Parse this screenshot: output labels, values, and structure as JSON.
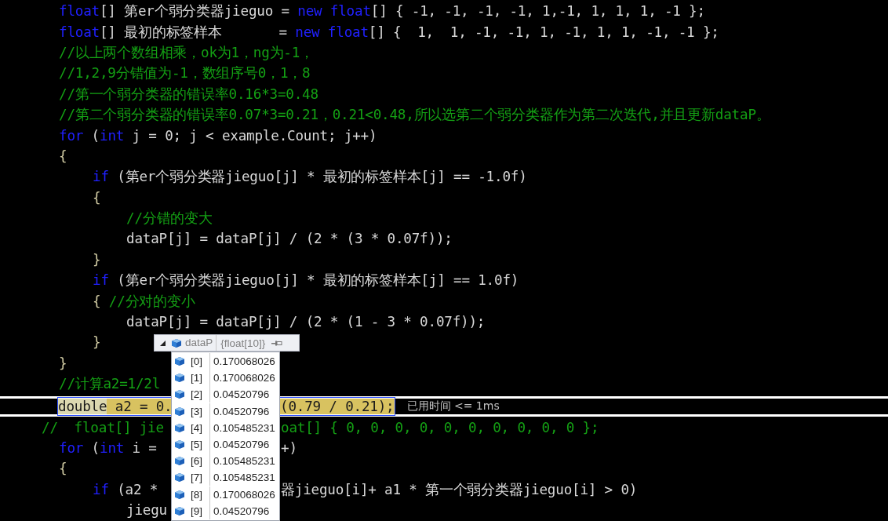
{
  "editor": {
    "lines": [
      {
        "tokens": [
          {
            "kind": "keyword",
            "text": "float"
          },
          {
            "kind": "plain",
            "text": "[] 第er个弱分类器jieguo = "
          },
          {
            "kind": "keyword",
            "text": "new float"
          },
          {
            "kind": "plain",
            "text": "[] { -1, -1, -1, -1, 1,-1, 1, 1, 1, -1 };"
          }
        ]
      },
      {
        "tokens": [
          {
            "kind": "keyword",
            "text": "float"
          },
          {
            "kind": "plain",
            "text": "[] 最初的标签样本       = "
          },
          {
            "kind": "keyword",
            "text": "new float"
          },
          {
            "kind": "plain",
            "text": "[] {  1,  1, -1, -1, 1, -1, 1, 1, -1, -1 };"
          }
        ]
      },
      {
        "tokens": [
          {
            "kind": "comment",
            "text": "//以上两个数组相乘，ok为1，ng为-1，"
          }
        ]
      },
      {
        "tokens": [
          {
            "kind": "comment",
            "text": "//1,2,9分错值为-1，数组序号0，1，8"
          }
        ]
      },
      {
        "tokens": [
          {
            "kind": "comment",
            "text": "//第一个弱分类器的错误率0.16*3=0.48"
          }
        ]
      },
      {
        "tokens": [
          {
            "kind": "comment",
            "text": "//第二个弱分类器的错误率0.07*3=0.21，0.21<0.48,所以选第二个弱分类器作为第二次迭代,并且更新dataP。"
          }
        ]
      },
      {
        "tokens": [
          {
            "kind": "keyword",
            "text": "for"
          },
          {
            "kind": "plain",
            "text": " ("
          },
          {
            "kind": "keyword",
            "text": "int"
          },
          {
            "kind": "plain",
            "text": " j = 0; j < example.Count; j++)"
          }
        ]
      },
      {
        "tokens": [
          {
            "kind": "brace",
            "text": "{"
          }
        ],
        "children": [
          {
            "tokens": [
              {
                "kind": "keyword",
                "text": "if"
              },
              {
                "kind": "plain",
                "text": " (第er个弱分类器jieguo[j] * 最初的标签样本[j] == -1.0f)"
              }
            ]
          },
          {
            "tokens": [
              {
                "kind": "brace",
                "text": "{"
              }
            ],
            "children": [
              {
                "tokens": [
                  {
                    "kind": "comment",
                    "text": "//分错的变大"
                  }
                ]
              },
              {
                "tokens": [
                  {
                    "kind": "plain",
                    "text": "dataP[j] = dataP[j] / (2 * (3 * 0.07f));"
                  }
                ]
              }
            ]
          },
          {
            "tokens": [
              {
                "kind": "brace",
                "text": "}"
              }
            ]
          },
          {
            "tokens": [
              {
                "kind": "keyword",
                "text": "if"
              },
              {
                "kind": "plain",
                "text": " (第er个弱分类器jieguo[j] * 最初的标签样本[j] == 1.0f)"
              }
            ]
          },
          {
            "tokens": [
              {
                "kind": "brace",
                "text": "{ "
              },
              {
                "kind": "comment",
                "text": "//分对的变小"
              }
            ],
            "children": [
              {
                "tokens": [
                  {
                    "kind": "plain",
                    "text": "dataP[j] = dataP[j] / (2 * (1 - 3 * 0.07f));"
                  }
                ]
              }
            ]
          },
          {
            "tokens": [
              {
                "kind": "brace",
                "text": "}"
              }
            ]
          }
        ]
      },
      {
        "tokens": [
          {
            "kind": "brace",
            "text": "}"
          }
        ]
      },
      {
        "tokens": [
          {
            "kind": "comment",
            "text": "//计算a2=1/2l"
          }
        ]
      },
      {
        "current": true,
        "tokens": [
          {
            "kind": "statement",
            "text": "double"
          },
          {
            "kind": "active",
            "text": " a2 = 0."
          }
        ],
        "after_tip": [
          {
            "kind": "active",
            "text": "(0.79 / 0.21);"
          }
        ],
        "elapsed": "已用时间 <= 1ms"
      },
      {
        "outdent": true,
        "tokens": [
          {
            "kind": "comment",
            "text": "//  float[] jie"
          }
        ],
        "after_tip": [
          {
            "kind": "comment",
            "text": "oat[] { 0, 0, 0, 0, 0, 0, 0, 0, 0, 0 };"
          }
        ]
      },
      {
        "tokens": [
          {
            "kind": "keyword",
            "text": "for"
          },
          {
            "kind": "plain",
            "text": " ("
          },
          {
            "kind": "keyword",
            "text": "int"
          },
          {
            "kind": "plain",
            "text": " i = "
          }
        ],
        "after_tip": [
          {
            "kind": "plain",
            "text": "+)"
          }
        ]
      },
      {
        "tokens": [
          {
            "kind": "brace",
            "text": "{"
          }
        ],
        "children": [
          {
            "tokens": [
              {
                "kind": "keyword",
                "text": "if"
              },
              {
                "kind": "plain",
                "text": " (a2 * "
              }
            ],
            "after_tip": [
              {
                "kind": "plain",
                "text": "器jieguo[i]+ a1 * 第一个弱分类器jieguo[i] > 0)"
              }
            ],
            "children": [
              {
                "tokens": [
                  {
                    "kind": "plain",
                    "text": "jiegu"
                  }
                ]
              }
            ]
          }
        ]
      }
    ]
  },
  "datatip": {
    "expanded": true,
    "name": "dataP",
    "type": "{float[10]}",
    "items": [
      {
        "index": "[0]",
        "value": "0.170068026"
      },
      {
        "index": "[1]",
        "value": "0.170068026"
      },
      {
        "index": "[2]",
        "value": "0.04520796"
      },
      {
        "index": "[3]",
        "value": "0.04520796"
      },
      {
        "index": "[4]",
        "value": "0.105485231"
      },
      {
        "index": "[5]",
        "value": "0.04520796"
      },
      {
        "index": "[6]",
        "value": "0.105485231"
      },
      {
        "index": "[7]",
        "value": "0.105485231"
      },
      {
        "index": "[8]",
        "value": "0.170068026"
      },
      {
        "index": "[9]",
        "value": "0.04520796"
      }
    ]
  }
}
